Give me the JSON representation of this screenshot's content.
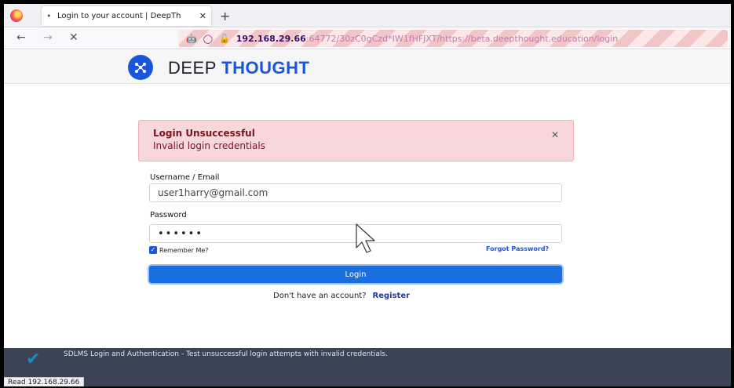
{
  "browser": {
    "tab_title": "Login to your account | DeepTh",
    "tab_close": "✕",
    "new_tab": "+",
    "url_host": "192.168.29.66",
    "url_rest": ":64772/30zC0gCzd*IW1fHFJXT/https://beta.deepthought.education/login",
    "status_text": "Read 192.168.29.66"
  },
  "header": {
    "brand_first": "DEEP",
    "brand_second": "THOUGHT"
  },
  "alert": {
    "title": "Login Unsuccessful",
    "message": "Invalid login credentials",
    "close": "✕"
  },
  "form": {
    "username_label": "Username / Email",
    "username_value": "user1harry@gmail.com",
    "password_label": "Password",
    "password_value": "••••••",
    "remember_label": "Remember Me?",
    "forgot_label": "Forgot Password?",
    "login_label": "Login",
    "no_account_text": "Don't have an account?",
    "register_label": "Register"
  },
  "caption": {
    "text": "SDLMS Login and Authentication - Test unsuccessful login attempts with invalid credentials."
  },
  "colors": {
    "accent": "#1a56db",
    "alert_bg": "#f8d7da",
    "alert_text": "#7a1421"
  }
}
